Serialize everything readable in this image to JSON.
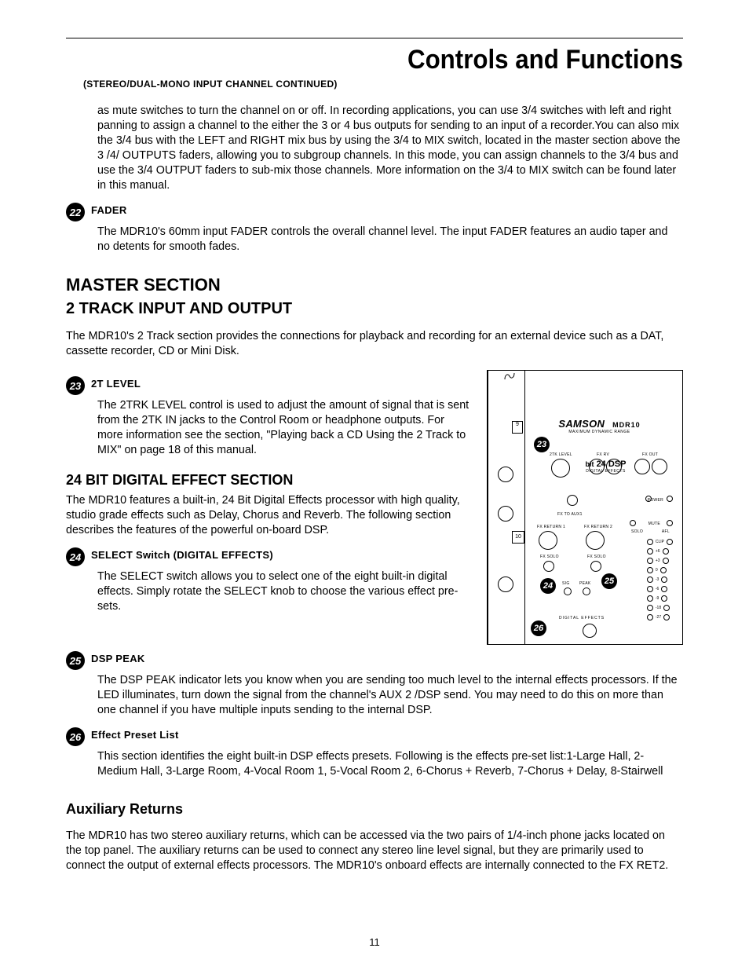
{
  "header": {
    "title": "Controls and Functions",
    "continued_label": "(STEREO/DUAL-MONO INPUT CHANNEL CONTINUED)"
  },
  "intro_paragraph": "as mute switches to turn the channel on or off. In recording applications, you can use 3/4 switches with left and right panning to assign a channel to the either the 3 or 4 bus outputs for sending to an input of a recorder.You can also mix the 3/4 bus with the LEFT and RIGHT mix bus by using the 3/4 to MIX switch, located in the master section above the 3 /4/ OUTPUTS faders, allowing you to subgroup channels. In this mode, you can assign channels to the 3/4 bus and use the 3/4 OUTPUT faders to sub-mix those channels. More information on the 3/4 to MIX switch can be found later in this manual.",
  "items": {
    "fader": {
      "num": "22",
      "heading": "FADER",
      "body": "The MDR10's 60mm input FADER controls the overall channel level.  The input FADER features an audio taper and no detents for smooth fades."
    },
    "t2level": {
      "num": "23",
      "heading": "2T LEVEL",
      "body": "The 2TRK LEVEL control is used to adjust the amount of signal that is sent from the 2TK IN jacks to the Control Room or headphone outputs.  For more information see the section, \"Playing back a CD Using the 2 Track to MIX\" on page 18 of this manual."
    },
    "select": {
      "num": "24",
      "heading": "SELECT Switch (DIGITAL EFFECTS)",
      "body": "The SELECT switch allows you to select one of the eight built-in digital effects.  Simply rotate the SELECT knob to choose the various effect pre-sets."
    },
    "dsppeak": {
      "num": "25",
      "heading": "DSP PEAK",
      "body": "The DSP PEAK indicator lets you know when you are sending too much level to the internal effects processors.  If the LED illuminates, turn down the signal from the channel's AUX 2 /DSP send. You may need to do this on more than one channel if you have multiple inputs sending to the internal DSP."
    },
    "presetlist": {
      "num": "26",
      "heading": "Effect Preset List",
      "body": "This section identifies the eight built-in DSP effects presets. Following is the effects pre-set list:1-Large Hall, 2-Medium Hall, 3-Large Room, 4-Vocal Room 1, 5-Vocal Room 2, 6-Chorus + Reverb, 7-Chorus + Delay, 8-Stairwell"
    }
  },
  "sections": {
    "master": "MASTER SECTION",
    "track2": "2 TRACK INPUT AND OUTPUT",
    "track2_body": "The MDR10's 2 Track section provides the connections for playback and recording for an external device such as a DAT, cassette recorder, CD or Mini Disk.",
    "dsp": "24 BIT DIGITAL EFFECT SECTION",
    "dsp_body": "The MDR10 features a built-in, 24 Bit Digital Effects processor with high quality, studio grade effects such as Delay, Chorus and Reverb.  The following section describes the features of the powerful on-board DSP.",
    "aux": "Auxiliary Returns",
    "aux_body": "The MDR10 has two stereo auxiliary returns, which can be accessed via the two pairs of 1/4-inch phone jacks located on the top panel. The auxiliary returns can be used to connect any stereo line level signal, but they are primarily used to connect the output of external effects processors.  The MDR10's onboard effects are internally connected to the FX RET2."
  },
  "diagram": {
    "brand": "SAMSON",
    "model": "MDR10",
    "subtitle": "MAXIMUM  DYNAMIC  RANGE",
    "dsp_label": "24 DSP",
    "dsp_sub": "DIGITAL EFFECTS",
    "labels": {
      "level_2tk": "2TK LEVEL",
      "fx_rv": "FX RV",
      "fx_out": "FX OUT",
      "fx_to_aux1": "FX TO AUX1",
      "power": "POWER",
      "fx_return_1": "FX RETURN 1",
      "fx_return_2": "FX RETURN 2",
      "mute": "MUTE",
      "solo": "SOLO",
      "afl": "AFL",
      "fx_solo": "FX  SOLO",
      "sig": "SIG",
      "peak": "PEAK",
      "digital_effects": "DIGITAL  EFFECTS",
      "c23": "23",
      "c24": "24",
      "c25": "25",
      "c26": "26"
    }
  },
  "page_number": "11"
}
